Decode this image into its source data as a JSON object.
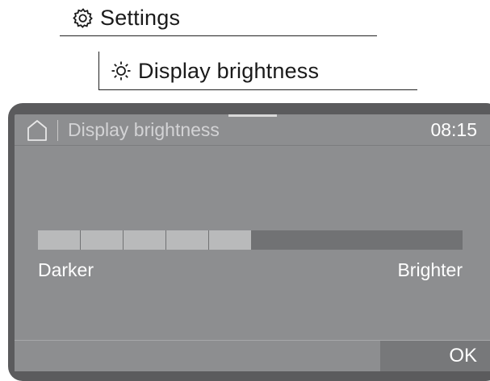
{
  "breadcrumb": {
    "settings": {
      "label": "Settings",
      "icon": "gear-icon"
    },
    "display_brightness": {
      "label": "Display brightness",
      "icon": "sun-icon"
    }
  },
  "display": {
    "status_bar": {
      "home_icon": "home-icon",
      "title": "Display brightness",
      "time": "08:15"
    },
    "brightness": {
      "level": 5,
      "max": 10,
      "min_label": "Darker",
      "max_label": "Brighter"
    },
    "ok_label": "OK"
  },
  "colors": {
    "bezel": "#5b5b5d",
    "screen": "#8d8e90",
    "slider_filled": "#b9babb",
    "slider_empty": "#717274",
    "ok_button": "#77787a"
  }
}
